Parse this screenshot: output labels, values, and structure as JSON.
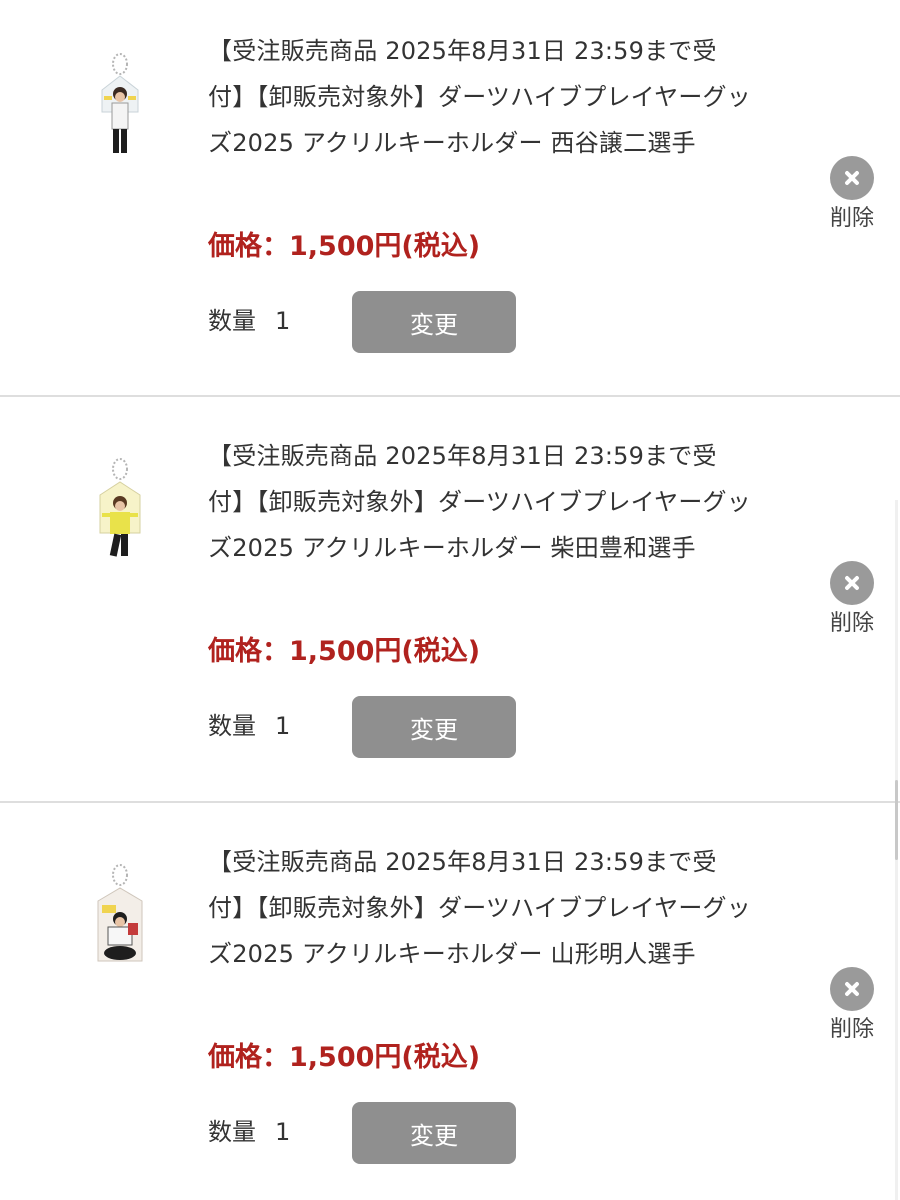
{
  "items": [
    {
      "title": "【受注販売商品 2025年8月31日 23:59まで受付】【卸販売対象外】ダーツハイブプレイヤーグッズ2025 アクリルキーホルダー 西谷譲二選手",
      "price": "価格：1,500円(税込)",
      "quantity_label": "数量",
      "quantity": "1",
      "change_label": "変更",
      "delete_label": "削除",
      "thumbnail_icon": "acrylic-keychain-thumbnail"
    },
    {
      "title": "【受注販売商品 2025年8月31日 23:59まで受付】【卸販売対象外】ダーツハイブプレイヤーグッズ2025 アクリルキーホルダー 柴田豊和選手",
      "price": "価格：1,500円(税込)",
      "quantity_label": "数量",
      "quantity": "1",
      "change_label": "変更",
      "delete_label": "削除",
      "thumbnail_icon": "acrylic-keychain-thumbnail"
    },
    {
      "title": "【受注販売商品 2025年8月31日 23:59まで受付】【卸販売対象外】ダーツハイブプレイヤーグッズ2025 アクリルキーホルダー 山形明人選手",
      "price": "価格：1,500円(税込)",
      "quantity_label": "数量",
      "quantity": "1",
      "change_label": "変更",
      "delete_label": "削除",
      "thumbnail_icon": "acrylic-keychain-thumbnail"
    }
  ],
  "colors": {
    "price": "#b0221e",
    "button": "#8f8f8f",
    "delete_icon": "#9a9a9a"
  }
}
